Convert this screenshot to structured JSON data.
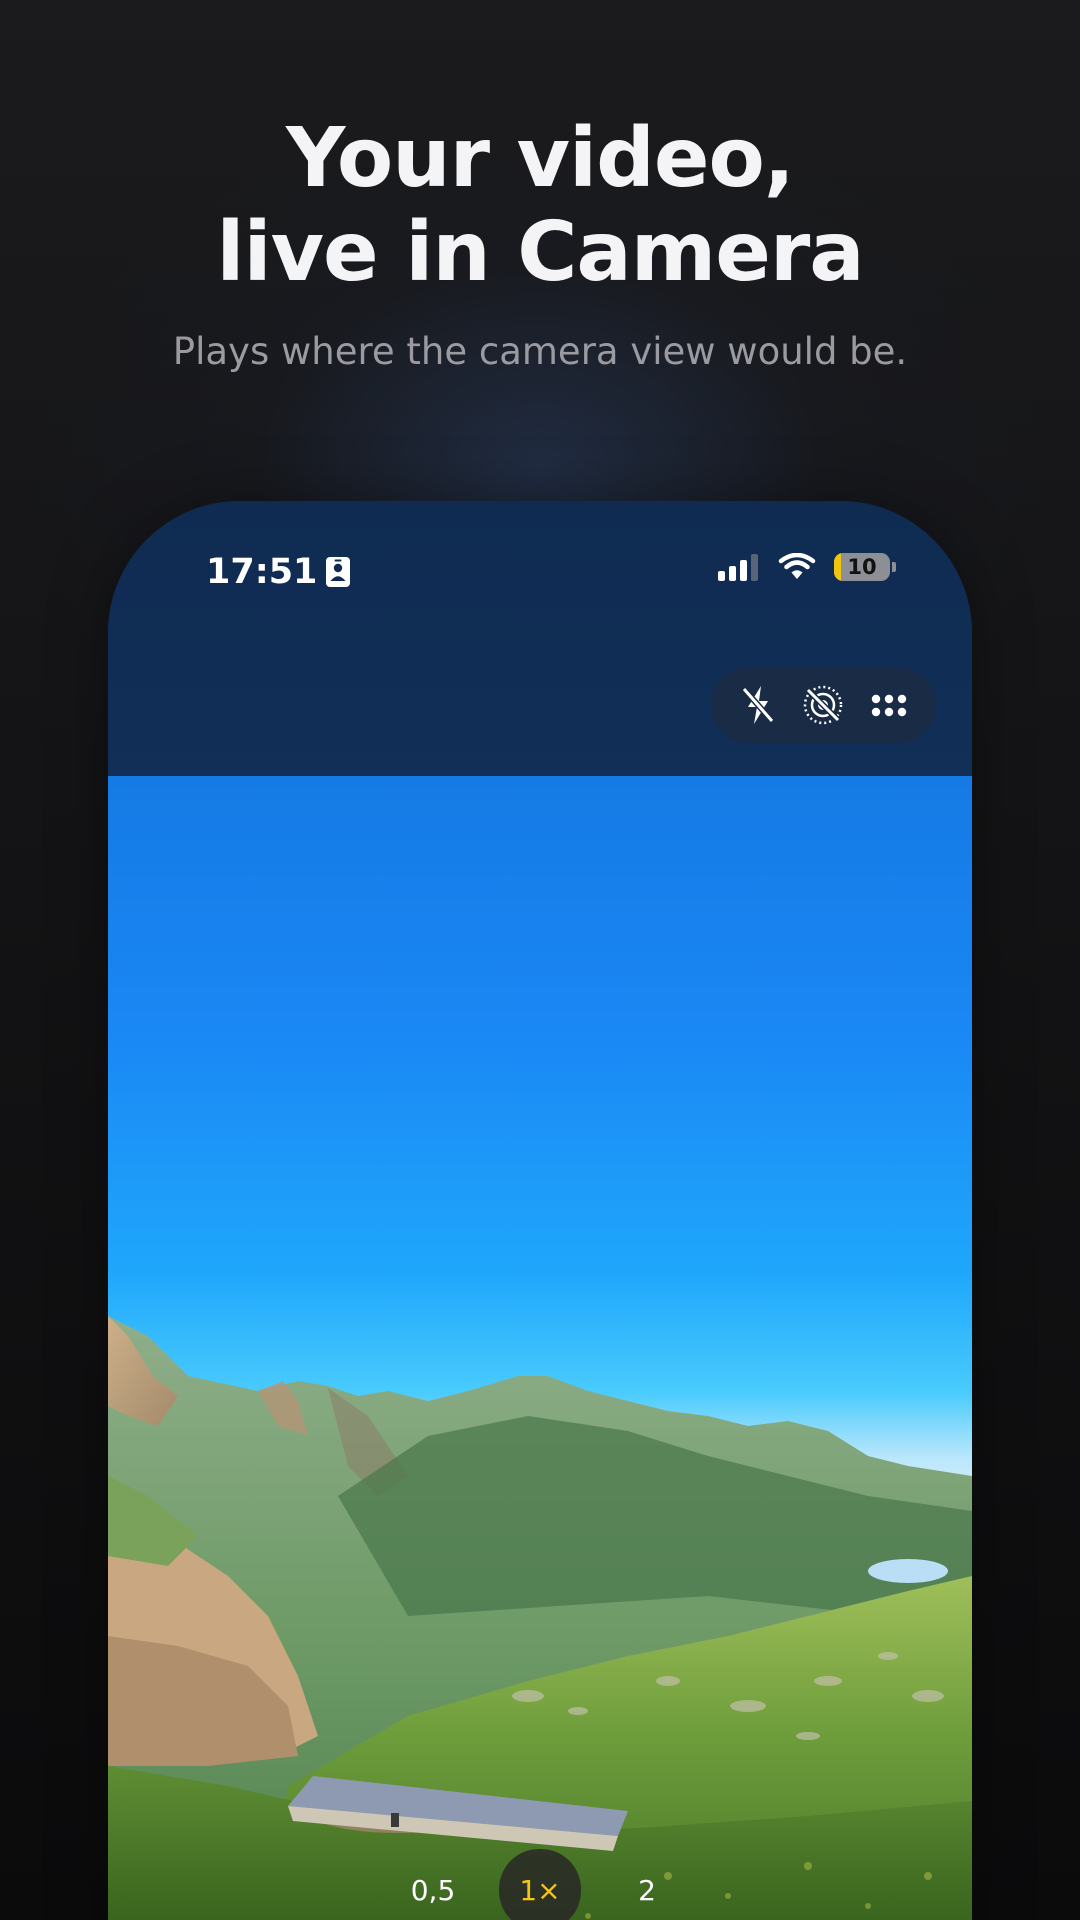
{
  "headline": {
    "line1": "Your video,",
    "line2": "live in Camera"
  },
  "subtitle": "Plays where the camera view would be.",
  "phone": {
    "status_bar": {
      "time": "17:51",
      "battery": "10"
    },
    "top_controls": {
      "icons": [
        "flash-off-icon",
        "live-photo-off-icon",
        "more-icon"
      ]
    },
    "zoom": {
      "options": [
        "0,5",
        "1×",
        "2"
      ],
      "selected": "1×"
    }
  },
  "colors": {
    "accent": "#f5c518",
    "battery_fill": "#f1c40f"
  }
}
